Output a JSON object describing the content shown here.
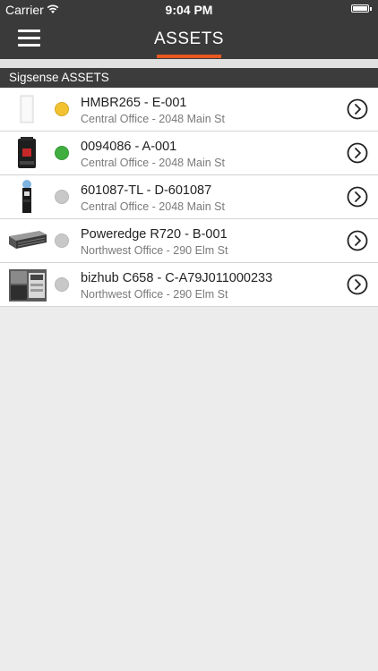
{
  "status_bar": {
    "carrier": "Carrier",
    "time": "9:04 PM"
  },
  "nav": {
    "title": "ASSETS",
    "accent_color": "#e8581f"
  },
  "section": {
    "header": "Sigsense ASSETS"
  },
  "assets": [
    {
      "title": "HMBR265 - E-001",
      "location": "Central Office - 2048 Main St",
      "status_color": "#f2c230",
      "thumb": "wall-sensor"
    },
    {
      "title": "0094086 - A-001",
      "location": "Central Office - 2048 Main St",
      "status_color": "#3fae3f",
      "thumb": "coffee-machine"
    },
    {
      "title": "601087-TL - D-601087",
      "location": "Central Office - 2048 Main St",
      "status_color": "#c8c8c8",
      "thumb": "water-cooler"
    },
    {
      "title": "Poweredge R720 - B-001",
      "location": "Northwest Office - 290 Elm St",
      "status_color": "#c8c8c8",
      "thumb": "rack-server"
    },
    {
      "title": "bizhub C658 - C-A79J011000233",
      "location": "Northwest Office - 290 Elm St",
      "status_color": "#c8c8c8",
      "thumb": "copier"
    }
  ]
}
